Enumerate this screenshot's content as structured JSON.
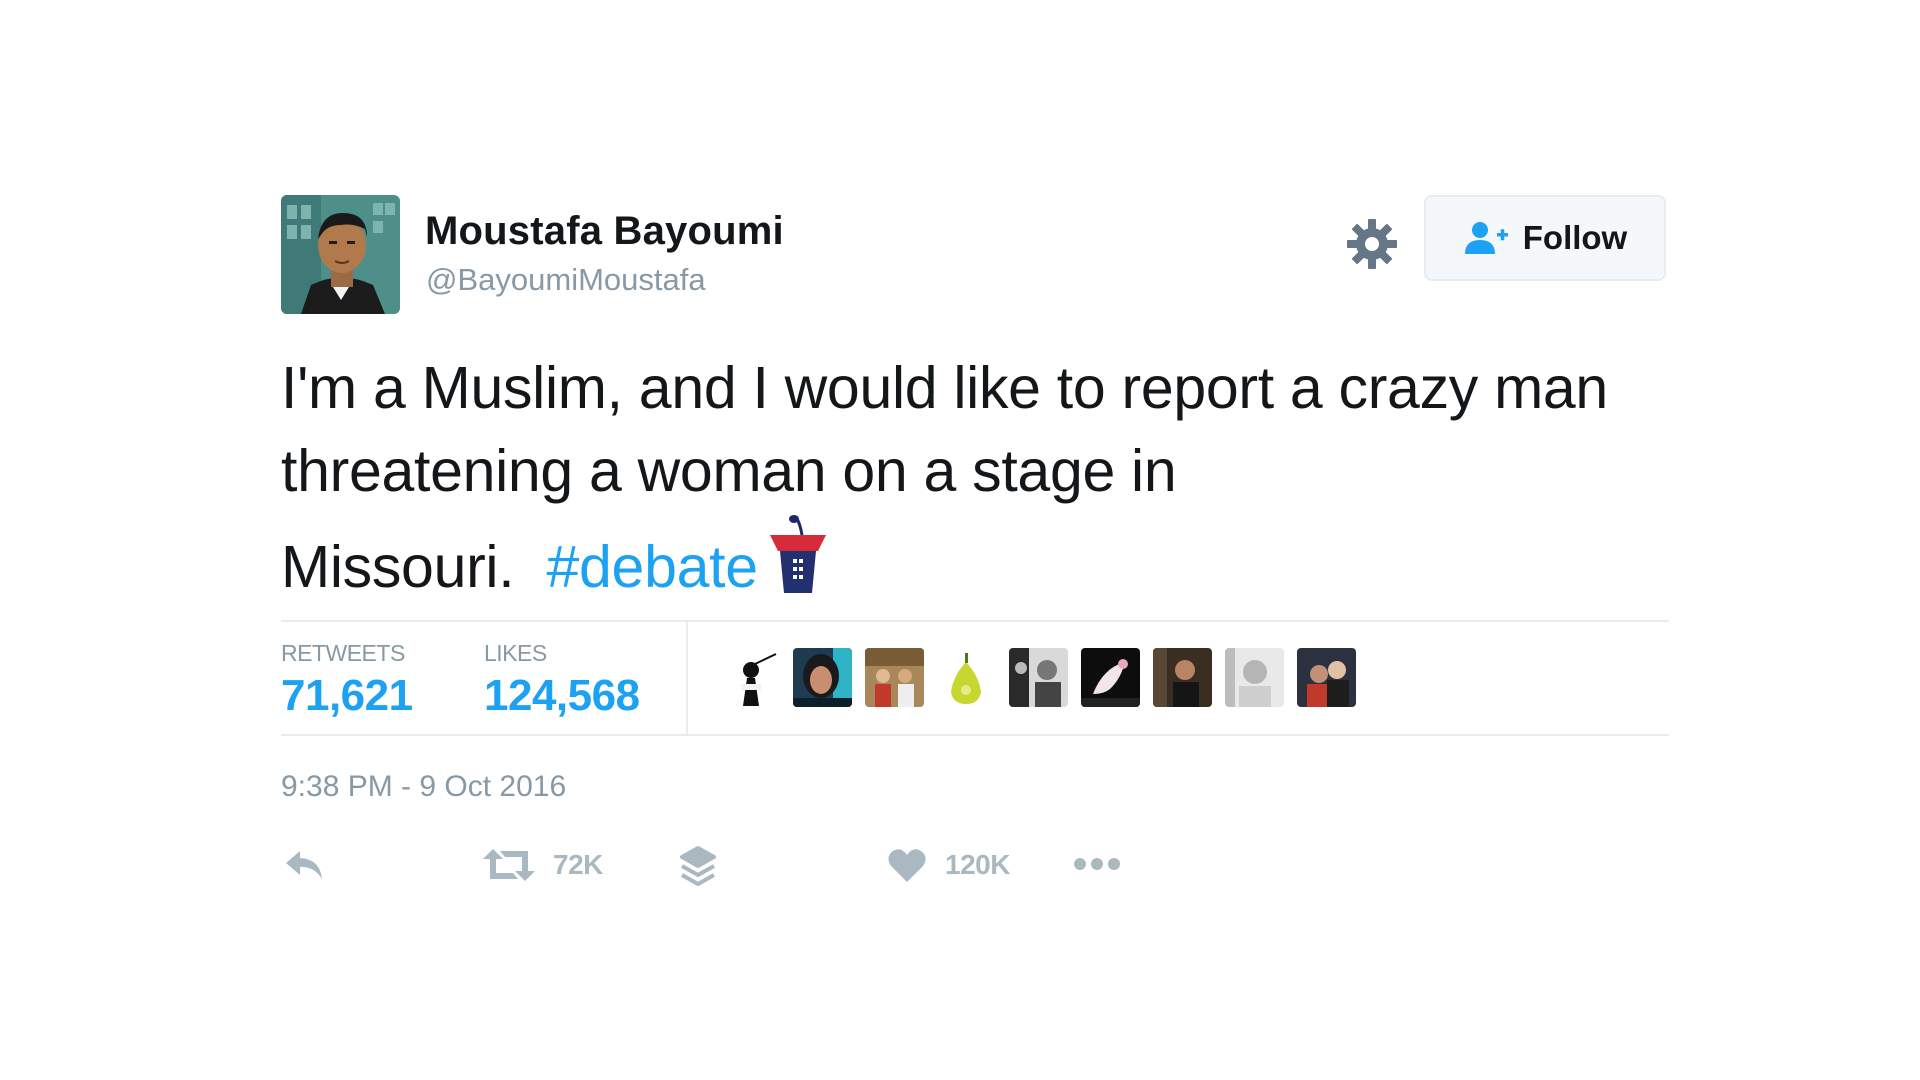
{
  "user": {
    "name": "Moustafa Bayoumi",
    "handle": "@BayoumiMoustafa",
    "avatar_icon": "illustrated-portrait-avatar"
  },
  "header": {
    "settings_icon": "gear-icon",
    "follow_label": "Follow",
    "follow_icon": "add-user-icon"
  },
  "tweet": {
    "text_before_hashtag": "I'm a Muslim, and I would like to report a crazy man threatening a woman on a stage in Missouri.",
    "hashtag": "#debate",
    "hashtag_emoji": "debate-podium-icon"
  },
  "stats": {
    "retweets_label": "RETWEETS",
    "retweets_value": "71,621",
    "likes_label": "LIKES",
    "likes_value": "124,568",
    "liker_avatars": [
      "liker-avatar-1",
      "liker-avatar-2",
      "liker-avatar-3",
      "liker-avatar-4",
      "liker-avatar-5",
      "liker-avatar-6",
      "liker-avatar-7",
      "liker-avatar-8",
      "liker-avatar-9"
    ]
  },
  "timestamp": "9:38 PM - 9 Oct 2016",
  "actions": {
    "reply_icon": "reply-icon",
    "retweet_icon": "retweet-icon",
    "retweet_count": "72K",
    "stack_icon": "stack-icon",
    "like_icon": "heart-icon",
    "like_count": "120K",
    "more_icon": "more-icon"
  },
  "colors": {
    "accent": "#1da1f2",
    "muted": "#8899a6",
    "icon": "#aab8c2",
    "text": "#14171a",
    "border": "#e6ecf0"
  }
}
